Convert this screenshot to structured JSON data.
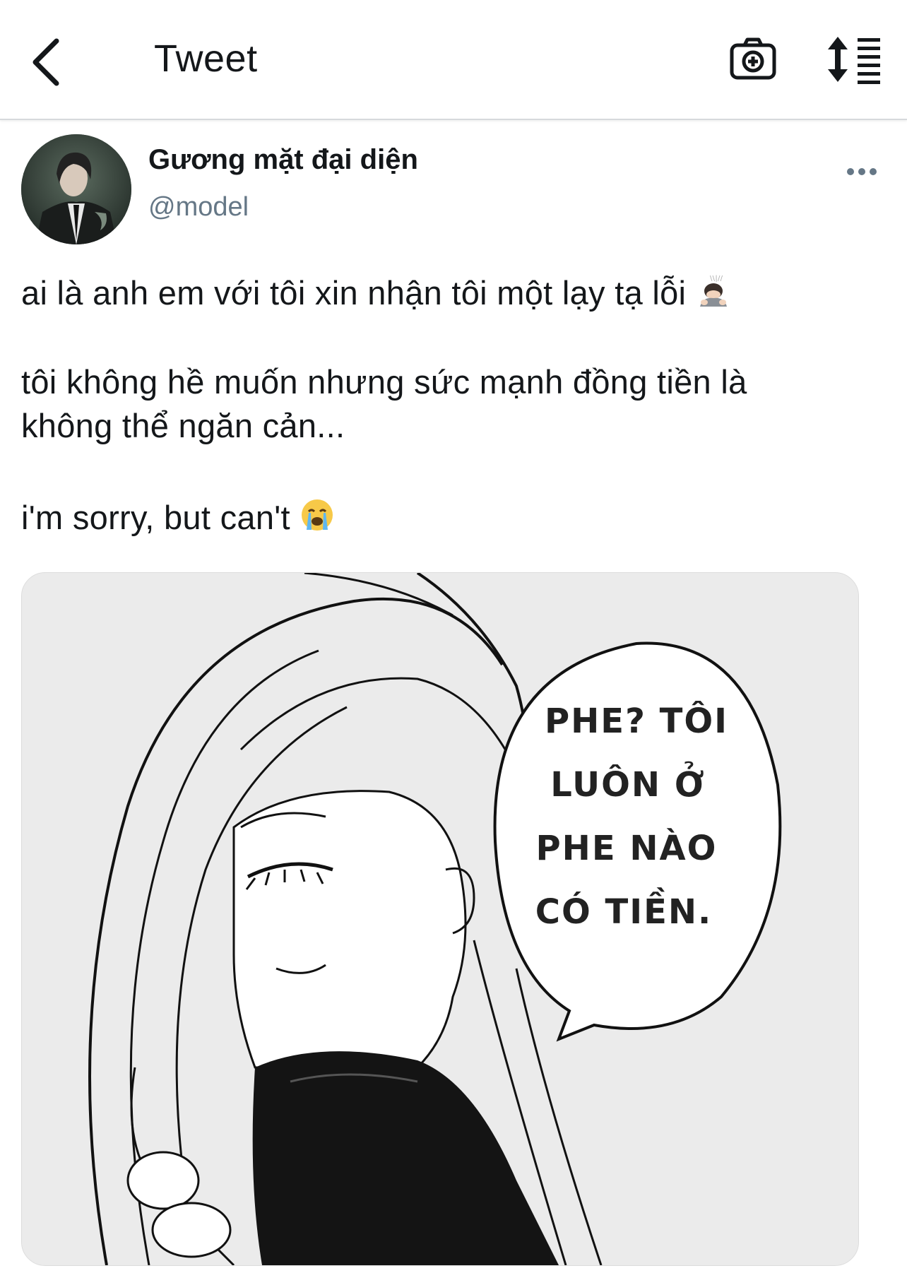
{
  "header": {
    "title": "Tweet"
  },
  "tweet": {
    "display_name": "Gương mặt đại diện",
    "handle": "@model",
    "text_line_1": "ai là anh em với tôi xin nhận tôi một lạy tạ lỗi",
    "text_line_2": "tôi không hề muốn nhưng sức mạnh đồng tiền là",
    "text_line_3": "không thể ngăn cản...",
    "text_line_4": "i'm sorry, but can't"
  },
  "media": {
    "bubble_lines": [
      "PHE? TÔI",
      "LUÔN Ở",
      "PHE NÀO",
      "CÓ TIỀN."
    ]
  },
  "icons": {
    "back": "chevron-left-icon",
    "camera": "camera-plus-icon",
    "sort": "sort-list-icon",
    "more": "more-dots-icon"
  }
}
